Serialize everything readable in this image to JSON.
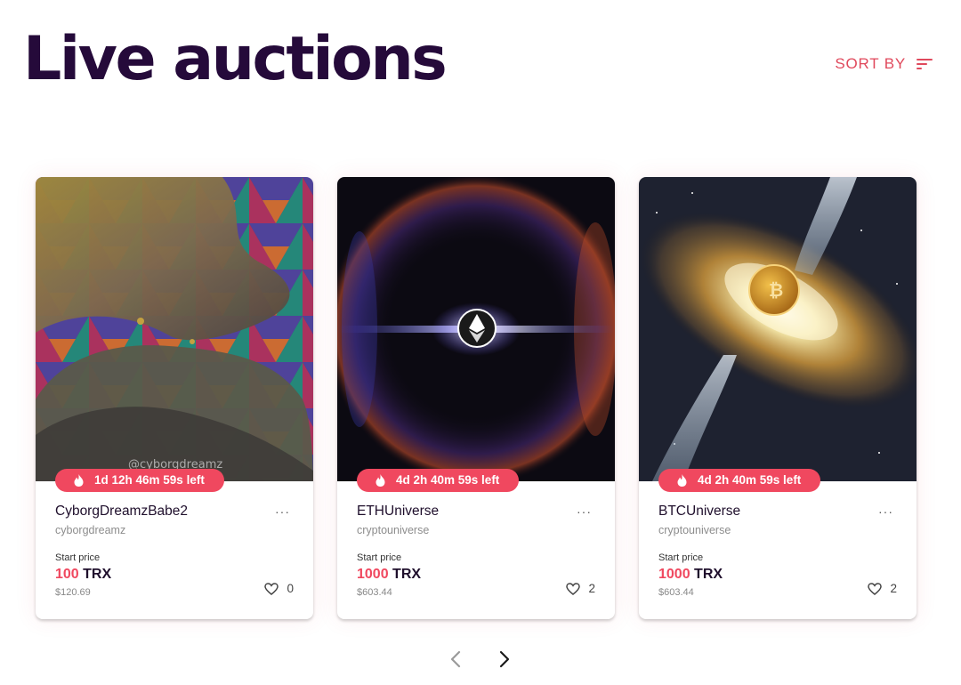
{
  "header": {
    "title": "Live auctions",
    "sort_label": "SORT BY"
  },
  "cards": [
    {
      "timer": "1d 12h 46m 59s left",
      "title": "CyborgDreamzBabe2",
      "owner": "cyborgdreamz",
      "price_label": "Start price",
      "price_amount": "100",
      "price_unit": "TRX",
      "price_usd": "$120.69",
      "likes": "0",
      "watermark": "@cyborgdreamz"
    },
    {
      "timer": "4d 2h 40m 59s left",
      "title": "ETHUniverse",
      "owner": "cryptouniverse",
      "price_label": "Start price",
      "price_amount": "1000",
      "price_unit": "TRX",
      "price_usd": "$603.44",
      "likes": "2"
    },
    {
      "timer": "4d 2h 40m 59s left",
      "title": "BTCUniverse",
      "owner": "cryptouniverse",
      "price_label": "Start price",
      "price_amount": "1000",
      "price_unit": "TRX",
      "price_usd": "$603.44",
      "likes": "2"
    }
  ],
  "menu_glyph": "···",
  "colors": {
    "accent": "#f0485f",
    "title": "#250a3a",
    "sort": "#e0495c"
  },
  "icons": {
    "sort": "sort-lines-icon",
    "timer": "fire-icon",
    "like": "heart-outline-icon",
    "prev": "chevron-left-icon",
    "next": "chevron-right-icon"
  }
}
